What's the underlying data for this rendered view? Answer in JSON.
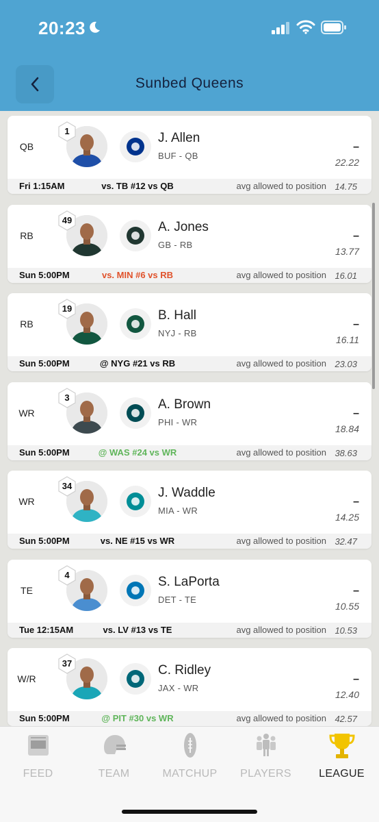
{
  "status_bar": {
    "time": "20:23"
  },
  "header": {
    "title": "Sunbed Queens"
  },
  "players": [
    {
      "position": "QB",
      "rank": "1",
      "name": "J. Allen",
      "team_pos": "BUF - QB",
      "score": "–",
      "projection": "22.22",
      "game_time": "Fri 1:15AM",
      "matchup": "vs. TB #12 vs QB",
      "matchup_color": "neutral",
      "avg_label": "avg allowed to position",
      "avg_value": "14.75",
      "team_color": "#00338D",
      "jersey": "#1f4fa8"
    },
    {
      "position": "RB",
      "rank": "49",
      "name": "A. Jones",
      "team_pos": "GB - RB",
      "score": "–",
      "projection": "13.77",
      "game_time": "Sun 5:00PM",
      "matchup": "vs. MIN #6 vs RB",
      "matchup_color": "red",
      "avg_label": "avg allowed to position",
      "avg_value": "16.01",
      "team_color": "#203731",
      "jersey": "#203731"
    },
    {
      "position": "RB",
      "rank": "19",
      "name": "B. Hall",
      "team_pos": "NYJ - RB",
      "score": "–",
      "projection": "16.11",
      "game_time": "Sun 5:00PM",
      "matchup": "@ NYG #21 vs RB",
      "matchup_color": "neutral",
      "avg_label": "avg allowed to position",
      "avg_value": "23.03",
      "team_color": "#125740",
      "jersey": "#125740"
    },
    {
      "position": "WR",
      "rank": "3",
      "name": "A. Brown",
      "team_pos": "PHI - WR",
      "score": "–",
      "projection": "18.84",
      "game_time": "Sun 5:00PM",
      "matchup": "@ WAS #24 vs WR",
      "matchup_color": "green",
      "avg_label": "avg allowed to position",
      "avg_value": "38.63",
      "team_color": "#004C54",
      "jersey": "#3d4a4f"
    },
    {
      "position": "WR",
      "rank": "34",
      "name": "J. Waddle",
      "team_pos": "MIA - WR",
      "score": "–",
      "projection": "14.25",
      "game_time": "Sun 5:00PM",
      "matchup": "vs. NE #15 vs WR",
      "matchup_color": "neutral",
      "avg_label": "avg allowed to position",
      "avg_value": "32.47",
      "team_color": "#008E97",
      "jersey": "#2fb3c4"
    },
    {
      "position": "TE",
      "rank": "4",
      "name": "S. LaPorta",
      "team_pos": "DET - TE",
      "score": "–",
      "projection": "10.55",
      "game_time": "Tue 12:15AM",
      "matchup": "vs. LV #13 vs TE",
      "matchup_color": "neutral",
      "avg_label": "avg allowed to position",
      "avg_value": "10.53",
      "team_color": "#0076B6",
      "jersey": "#4a8ed0"
    },
    {
      "position": "W/R",
      "rank": "37",
      "name": "C. Ridley",
      "team_pos": "JAX - WR",
      "score": "–",
      "projection": "12.40",
      "game_time": "Sun 5:00PM",
      "matchup": "@ PIT #30 vs WR",
      "matchup_color": "green",
      "avg_label": "avg allowed to position",
      "avg_value": "42.57",
      "team_color": "#006778",
      "jersey": "#1aa6b7"
    }
  ],
  "tabs": [
    {
      "label": "FEED",
      "icon": "feed-icon",
      "active": false
    },
    {
      "label": "TEAM",
      "icon": "helmet-icon",
      "active": false
    },
    {
      "label": "MATCHUP",
      "icon": "football-icon",
      "active": false
    },
    {
      "label": "PLAYERS",
      "icon": "players-icon",
      "active": false
    },
    {
      "label": "LEAGUE",
      "icon": "trophy-icon",
      "active": true
    }
  ],
  "colors": {
    "header_bg": "#4fa4d2",
    "matchup_red": "#e0522b",
    "matchup_green": "#5fb55a",
    "active_tab_icon": "#f2c400"
  }
}
